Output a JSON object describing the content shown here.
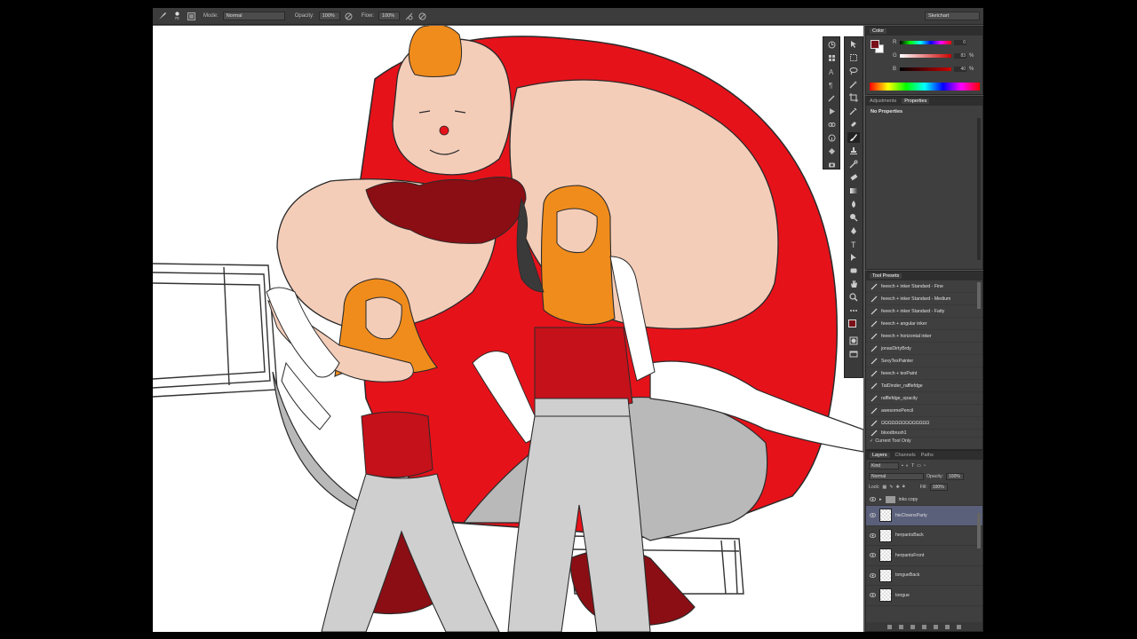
{
  "optionsBar": {
    "brushSize": "70",
    "modeLabel": "Mode:",
    "modeValue": "Normal",
    "opacityLabel": "Opacity:",
    "opacityValue": "100%",
    "flowLabel": "Flow:",
    "flowValue": "100%",
    "workspace": "Sketchart"
  },
  "colorPanel": {
    "tab": "Color",
    "channels": [
      {
        "label": "R",
        "value": "0"
      },
      {
        "label": "G",
        "value": "83"
      },
      {
        "label": "B",
        "value": "40"
      }
    ],
    "percent": "%",
    "fgColor": "#7a1018",
    "bgColor": "#ffffff"
  },
  "propertiesPanel": {
    "tabs": [
      "Adjustments",
      "Properties"
    ],
    "message": "No Properties"
  },
  "toolPresets": {
    "tab": "Tool Presets",
    "items": [
      "feeech + inker Standard - Fine",
      "feeech + inker Standard - Medium",
      "feeech + inker Standard - Fatty",
      "feeech + angular inker",
      "feeech + horizontal inker",
      "jonasDirtyBrdy",
      "SexyTexPainter",
      "feeech + texPaint",
      "TatDinder_rafflefdge",
      "rafflefdge_opacity",
      "awesomePencil",
      "ΩΩΩΩΩΩΩΩΩΩΩΩΩΩ",
      "bloodbrush1"
    ],
    "currentToolOnly": "Current Tool Only"
  },
  "layersPanel": {
    "tabs": [
      "Layers",
      "Channels",
      "Paths"
    ],
    "kind": "Kind",
    "blend": "Normal",
    "opacityLabel": "Opacity:",
    "opacityValue": "100%",
    "lockLabel": "Lock:",
    "fillLabel": "Fill:",
    "fillValue": "100%",
    "layers": [
      {
        "name": "inks copy",
        "type": "group"
      },
      {
        "name": "hisClownsParty",
        "type": "layer",
        "selected": true
      },
      {
        "name": "herpantsBack",
        "type": "layer"
      },
      {
        "name": "herpantsFront",
        "type": "layer"
      },
      {
        "name": "tongueBack",
        "type": "layer"
      },
      {
        "name": "tongue",
        "type": "layer"
      }
    ]
  },
  "palette": {
    "red": "#e6121a",
    "darkRed": "#8a0e14",
    "skin": "#f4cdb9",
    "hair": "#f08c1c",
    "grey": "#b9b9b9",
    "lightGrey": "#d9d9d9",
    "ink": "#2a2a2a"
  }
}
